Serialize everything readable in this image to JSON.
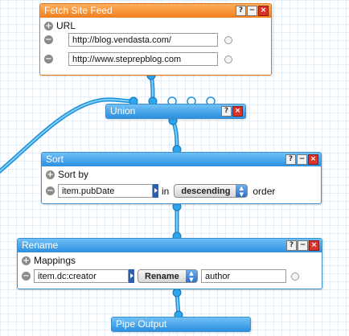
{
  "modules": {
    "fetch": {
      "title": "Fetch Site Feed",
      "section_label": "URL",
      "urls": [
        "http://blog.vendasta.com/",
        "http://www.steprepblog.com"
      ]
    },
    "union": {
      "title": "Union"
    },
    "sort": {
      "title": "Sort",
      "section_label": "Sort by",
      "field_value": "item.pubDate",
      "in_label": "in",
      "direction": "descending",
      "order_label": "order"
    },
    "rename": {
      "title": "Rename",
      "section_label": "Mappings",
      "from_value": "item.dc:creator",
      "operation": "Rename",
      "to_value": "author"
    },
    "output": {
      "title": "Pipe Output"
    }
  },
  "icons": {
    "help": "?",
    "minimize": "−",
    "close": "×",
    "add": "+",
    "remove": "−"
  },
  "colors": {
    "fetch_header": "#f07f1f",
    "module_header": "#2d8fdf",
    "wire": "#2aa7ee",
    "grid": "#e3eef8"
  }
}
